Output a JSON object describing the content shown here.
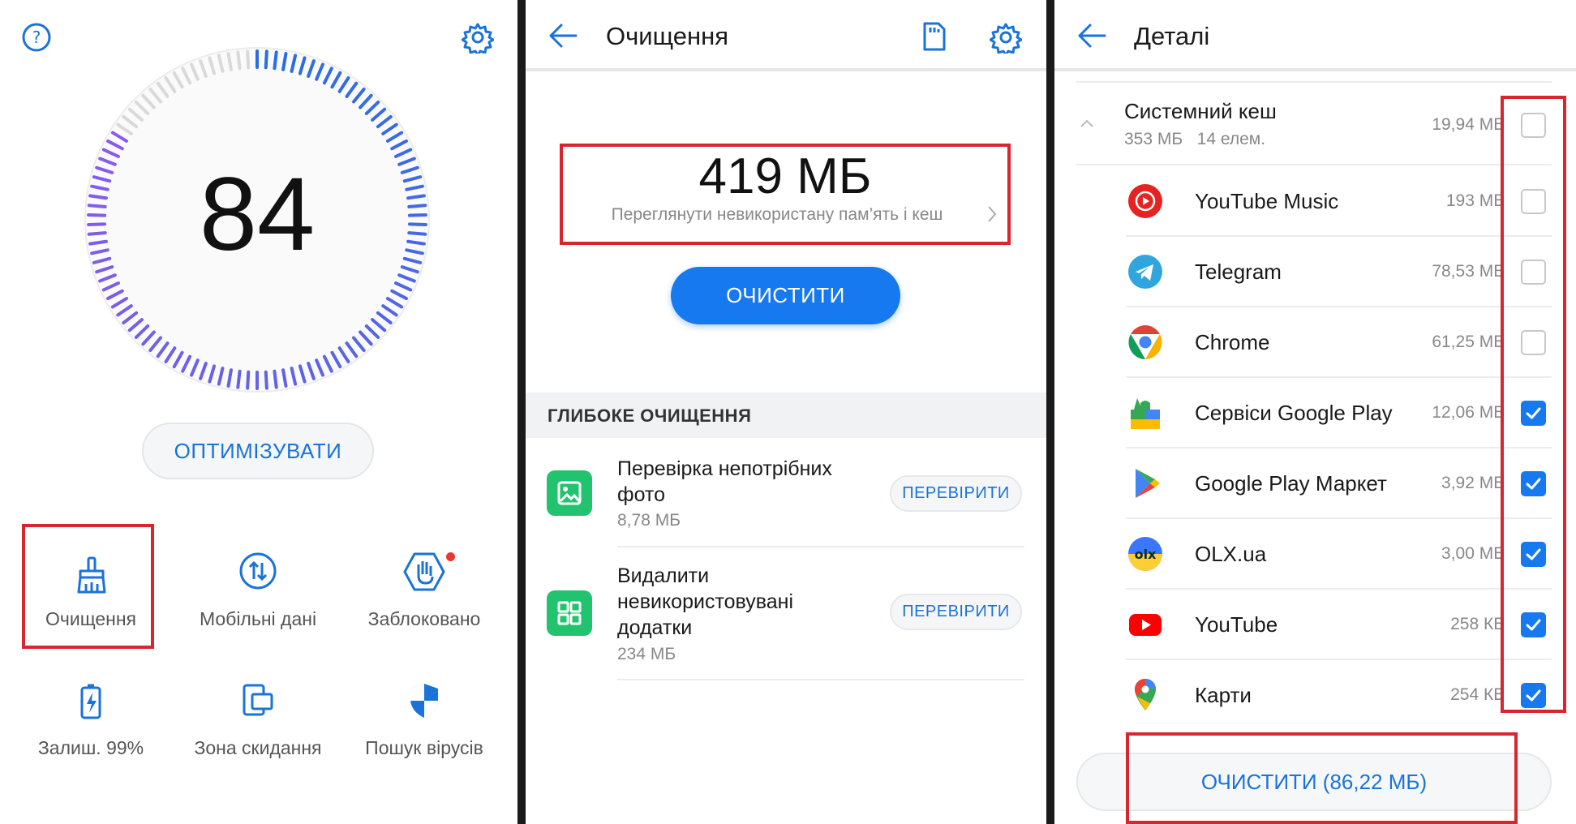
{
  "panel_optimizer": {
    "score": "84",
    "optimize_button": "ОПТИМІЗУВАТИ",
    "tiles": [
      {
        "label": "Очищення",
        "icon": "broom-icon"
      },
      {
        "label": "Мобільні дані",
        "icon": "data-transfer-icon"
      },
      {
        "label": "Заблоковано",
        "icon": "blocked-hand-icon"
      },
      {
        "label": "Залиш. 99%",
        "icon": "battery-icon"
      },
      {
        "label": "Зона скидання",
        "icon": "drop-zone-icon"
      },
      {
        "label": "Пошук вірусів",
        "icon": "shield-icon"
      }
    ],
    "colors": {
      "accent": "#1a73d9",
      "highlight": "#d8262e",
      "gauge_active": "#5b6ee0"
    }
  },
  "panel_cleanup": {
    "title": "Очищення",
    "storage_size": "419 МБ",
    "storage_link": "Переглянути невикористану пам’ять і кеш",
    "clean_button": "ОЧИСТИТИ",
    "section_title": "ГЛИБОКЕ ОЧИЩЕННЯ",
    "items": [
      {
        "title_line1": "Перевірка непотрібних",
        "title_line2": "фото",
        "title_line3": "",
        "size": "8,78 МБ",
        "action": "ПЕРЕВІРИТИ",
        "icon": "photo-icon"
      },
      {
        "title_line1": "Видалити",
        "title_line2": "невикористовувані",
        "title_line3": "додатки",
        "size": "234 МБ",
        "action": "ПЕРЕВІРИТИ",
        "icon": "apps-grid-icon"
      }
    ],
    "colors": {
      "primary_button": "#1679f0",
      "item_icon": "#21c36f"
    }
  },
  "panel_details": {
    "title": "Деталі",
    "group": {
      "name": "Системний кеш",
      "meta": "353 МБ   14 елем.",
      "size": "19,94 МБ",
      "checked": false
    },
    "apps": [
      {
        "name": "YouTube Music",
        "size": "193 МБ",
        "checked": false,
        "icon": "youtube-music-icon"
      },
      {
        "name": "Telegram",
        "size": "78,53 МБ",
        "checked": false,
        "icon": "telegram-icon"
      },
      {
        "name": "Chrome",
        "size": "61,25 МБ",
        "checked": false,
        "icon": "chrome-icon"
      },
      {
        "name": "Сервіси Google Play",
        "size": "12,06 МБ",
        "checked": true,
        "icon": "google-play-services-icon"
      },
      {
        "name": "Google Play Маркет",
        "size": "3,92 МБ",
        "checked": true,
        "icon": "google-play-store-icon"
      },
      {
        "name": "OLX.ua",
        "size": "3,00 МБ",
        "checked": true,
        "icon": "olx-icon"
      },
      {
        "name": "YouTube",
        "size": "258 КБ",
        "checked": true,
        "icon": "youtube-icon"
      },
      {
        "name": "Карти",
        "size": "254 КБ",
        "checked": true,
        "icon": "google-maps-icon"
      }
    ],
    "clean_button": "ОЧИСТИТИ (86,22 МБ)"
  }
}
